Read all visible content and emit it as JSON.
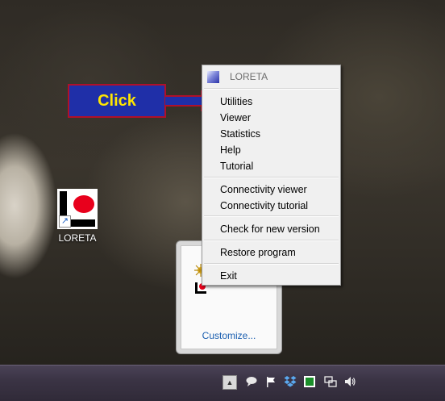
{
  "callout": {
    "text": "Click"
  },
  "desktop_icon": {
    "label": "LORETA"
  },
  "context_menu": {
    "title": "LORETA",
    "items": [
      "Utilities",
      "Viewer",
      "Statistics",
      "Help",
      "Tutorial",
      "Connectivity viewer",
      "Connectivity tutorial",
      "Check for new version",
      "Restore program",
      "Exit"
    ]
  },
  "tray_popup": {
    "customize_label": "Customize..."
  },
  "colors": {
    "callout_bg": "#1f2fa8",
    "callout_border": "#b0102a",
    "callout_text": "#ffe600",
    "menu_bg": "#f0f0f0",
    "link": "#1b5fb0"
  },
  "icons": [
    "loreta-app-icon",
    "shortcut-arrow-icon",
    "show-hidden-icons-chevron",
    "action-center-flag-icon",
    "dropbox-icon",
    "green-app-icon",
    "network-icon",
    "volume-icon"
  ]
}
